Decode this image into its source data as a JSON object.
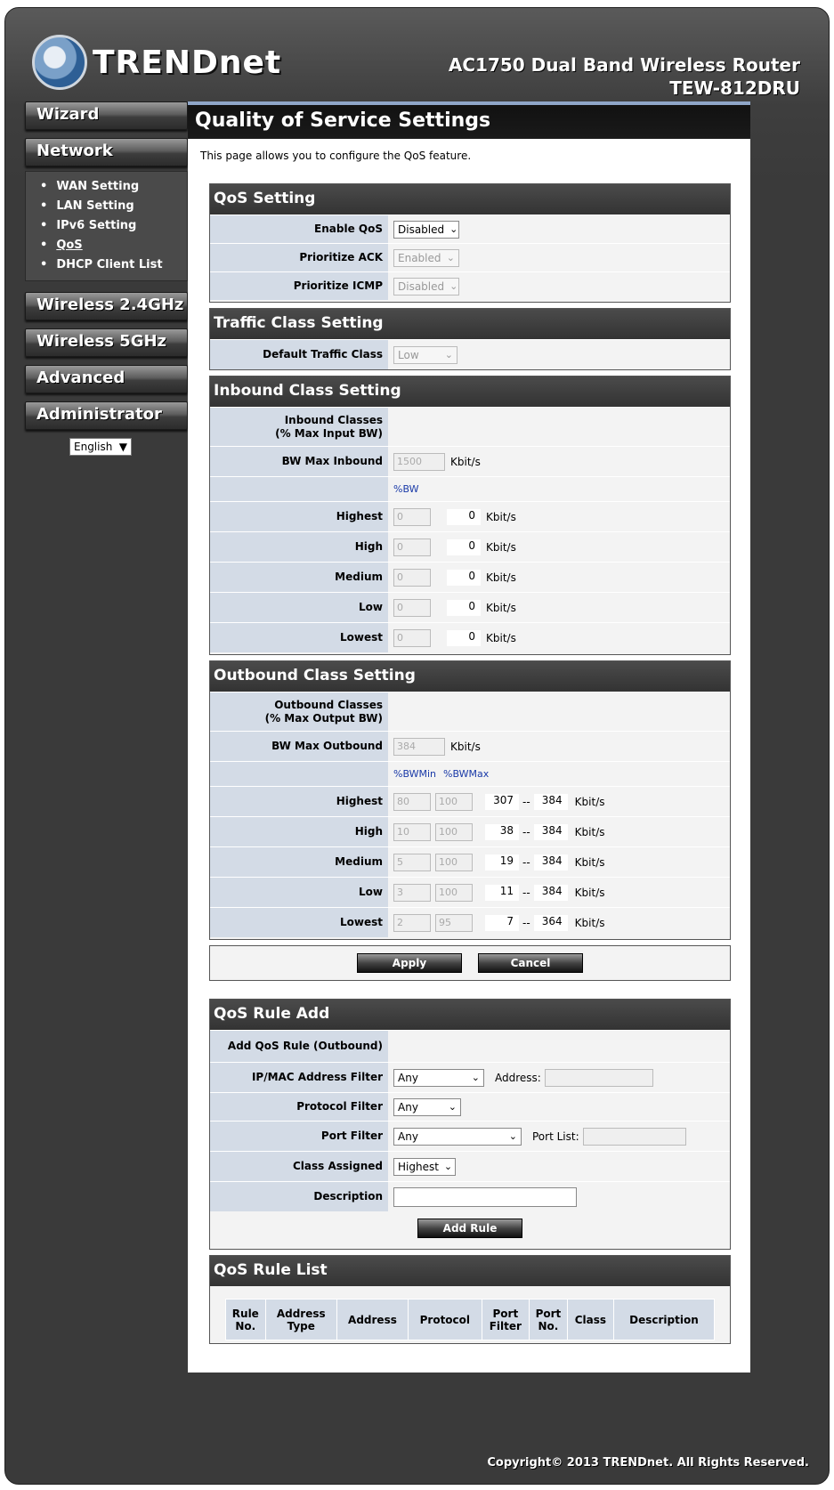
{
  "header": {
    "logo_text": "TRENDnet",
    "product_line1": "AC1750 Dual Band Wireless Router",
    "product_line2": "TEW-812DRU"
  },
  "sidebar": {
    "wizard": "Wizard",
    "network": "Network",
    "network_items": [
      "WAN Setting",
      "LAN Setting",
      "IPv6 Setting",
      "QoS",
      "DHCP Client List"
    ],
    "wireless24": "Wireless 2.4GHz",
    "wireless5": "Wireless 5GHz",
    "advanced": "Advanced",
    "administrator": "Administrator",
    "language": "English"
  },
  "page": {
    "title": "Quality of Service Settings",
    "description": "This page allows you to configure the QoS feature."
  },
  "qos": {
    "head": "QoS Setting",
    "enable_label": "Enable QoS",
    "enable_value": "Disabled",
    "ack_label": "Prioritize ACK",
    "ack_value": "Enabled",
    "icmp_label": "Prioritize ICMP",
    "icmp_value": "Disabled"
  },
  "traffic": {
    "head": "Traffic Class Setting",
    "label": "Default Traffic Class",
    "value": "Low"
  },
  "inbound": {
    "head": "Inbound Class Setting",
    "classes_l1": "Inbound Classes",
    "classes_l2": "(% Max Input BW)",
    "bw_label": "BW Max Inbound",
    "bw_value": "1500",
    "unit": "Kbit/s",
    "pct_label": "%BW",
    "rows": [
      {
        "name": "Highest",
        "pct": "0",
        "kbit": "0"
      },
      {
        "name": "High",
        "pct": "0",
        "kbit": "0"
      },
      {
        "name": "Medium",
        "pct": "0",
        "kbit": "0"
      },
      {
        "name": "Low",
        "pct": "0",
        "kbit": "0"
      },
      {
        "name": "Lowest",
        "pct": "0",
        "kbit": "0"
      }
    ]
  },
  "outbound": {
    "head": "Outbound Class Setting",
    "classes_l1": "Outbound Classes",
    "classes_l2": "(% Max Output BW)",
    "bw_label": "BW Max Outbound",
    "bw_value": "384",
    "unit": "Kbit/s",
    "min_label": "%BWMin",
    "max_label": "%BWMax",
    "sep": "--",
    "rows": [
      {
        "name": "Highest",
        "min": "80",
        "max": "100",
        "kmin": "307",
        "kmax": "384"
      },
      {
        "name": "High",
        "min": "10",
        "max": "100",
        "kmin": "38",
        "kmax": "384"
      },
      {
        "name": "Medium",
        "min": "5",
        "max": "100",
        "kmin": "19",
        "kmax": "384"
      },
      {
        "name": "Low",
        "min": "3",
        "max": "100",
        "kmin": "11",
        "kmax": "384"
      },
      {
        "name": "Lowest",
        "min": "2",
        "max": "95",
        "kmin": "7",
        "kmax": "364"
      }
    ]
  },
  "buttons": {
    "apply": "Apply",
    "cancel": "Cancel",
    "add_rule": "Add Rule"
  },
  "rule_add": {
    "head": "QoS Rule Add",
    "title": "Add QoS Rule (Outbound)",
    "ipmac_label": "IP/MAC Address Filter",
    "ipmac_value": "Any",
    "address_label": "Address:",
    "proto_label": "Protocol Filter",
    "proto_value": "Any",
    "port_label": "Port Filter",
    "port_value": "Any",
    "portlist_label": "Port List:",
    "class_label": "Class Assigned",
    "class_value": "Highest",
    "desc_label": "Description"
  },
  "rule_list": {
    "head": "QoS Rule List",
    "columns": [
      [
        "Rule",
        "No."
      ],
      [
        "Address",
        "Type"
      ],
      [
        "Address"
      ],
      [
        "Protocol"
      ],
      [
        "Port",
        "Filter"
      ],
      [
        "Port",
        "No."
      ],
      [
        "Class"
      ],
      [
        "Description"
      ]
    ]
  },
  "footer": {
    "copyright": "Copyright© 2013 TRENDnet. All Rights Reserved."
  }
}
